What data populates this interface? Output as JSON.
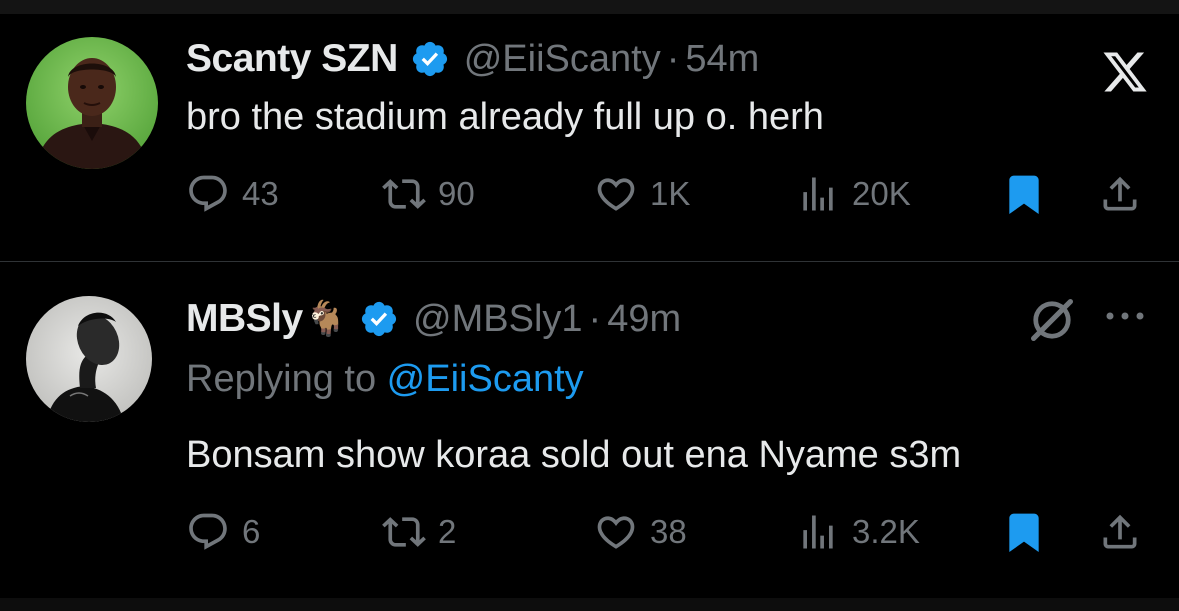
{
  "tweets": [
    {
      "name": "Scanty SZN",
      "handle": "@EiiScanty",
      "separator": "·",
      "time": "54m",
      "text": "bro the stadium already full up o. herh",
      "counts": {
        "replies": "43",
        "reposts": "90",
        "likes": "1K",
        "views": "20K"
      }
    },
    {
      "name": "MBSly",
      "name_emoji": "🐐",
      "handle": "@MBSly1",
      "separator": "·",
      "time": "49m",
      "replying_prefix": "Replying to ",
      "replying_to": "@EiiScanty",
      "text": "Bonsam show koraa sold out ena Nyame s3m",
      "counts": {
        "replies": "6",
        "reposts": "2",
        "likes": "38",
        "views": "3.2K"
      }
    }
  ],
  "icons": {
    "reply": "reply-icon",
    "repost": "repost-icon",
    "like": "heart-icon",
    "views": "views-icon",
    "bookmark": "bookmark-icon",
    "share": "share-icon",
    "verified": "verified-badge-icon",
    "x_logo": "x-logo-icon",
    "grok": "grok-icon",
    "more": "more-icon"
  },
  "colors": {
    "background": "#000000",
    "text": "#e7e9ea",
    "secondary": "#71767b",
    "accent": "#1d9bf0",
    "divider": "#2f3336"
  }
}
